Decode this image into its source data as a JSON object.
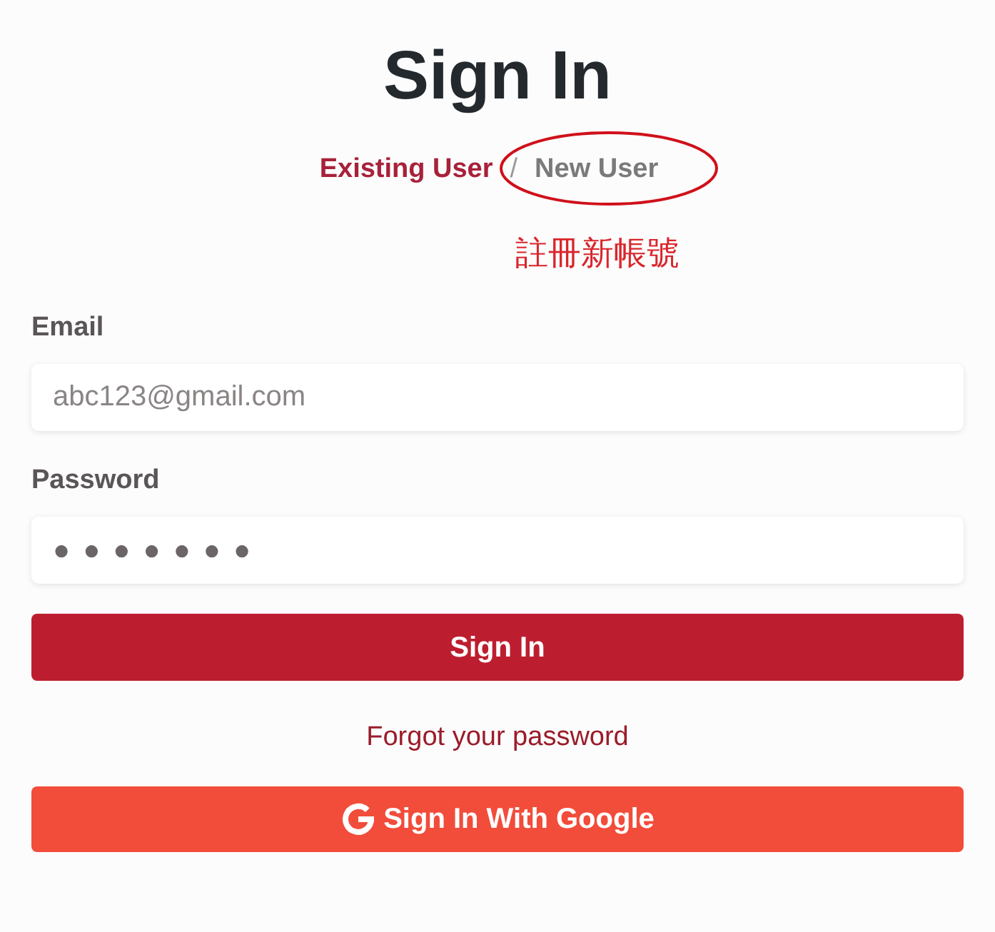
{
  "title": "Sign In",
  "tabs": [
    {
      "label": "Existing User",
      "selected": true
    },
    {
      "label": "New User",
      "selected": false
    }
  ],
  "tab_separator": "/",
  "annotation": {
    "text": "註冊新帳號"
  },
  "fields": [
    {
      "label": "Email",
      "kind": "text",
      "placeholder": "abc123@gmail.com"
    },
    {
      "label": "Password",
      "kind": "password",
      "value": "●●●●●●●"
    }
  ],
  "sign_in_button": {
    "label": "Sign In"
  },
  "forgot_link": "Forgot your password",
  "google_button": {
    "label": "Sign In With Google"
  }
}
